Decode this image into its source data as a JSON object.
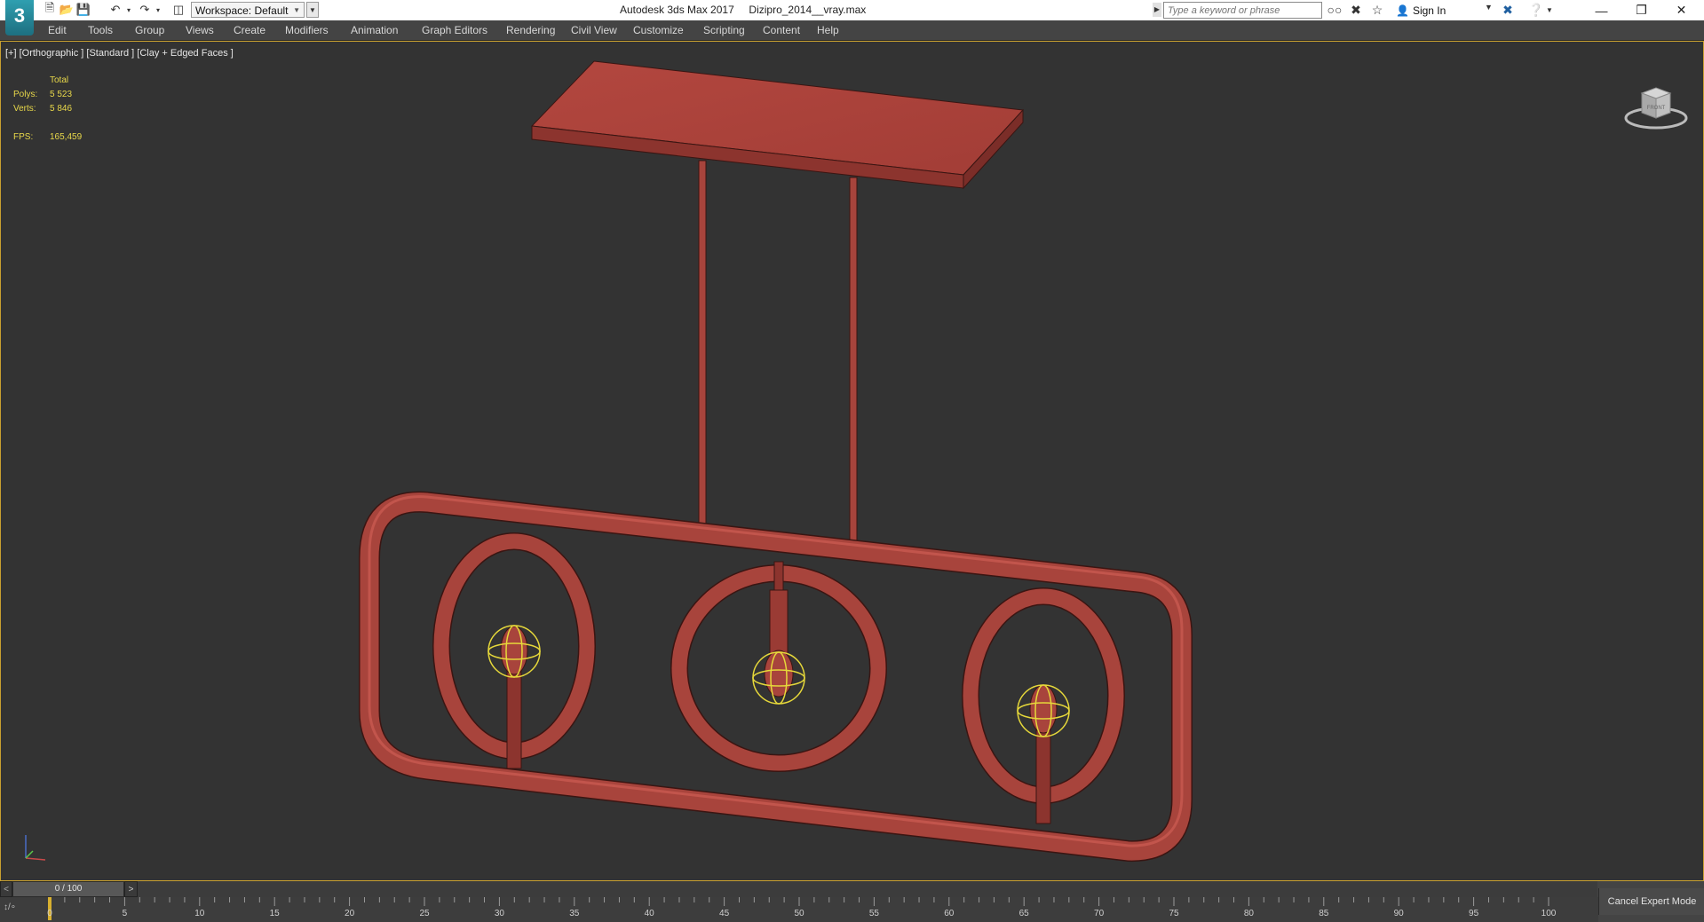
{
  "app": {
    "logo_text": "3",
    "title": "Autodesk 3ds Max 2017     Dizipro_2014__vray.max",
    "workspace_label": "Workspace: Default"
  },
  "search": {
    "placeholder": "Type a keyword or phrase"
  },
  "account": {
    "sign_in_label": "Sign In"
  },
  "menu": [
    "Edit",
    "Tools",
    "Group",
    "Views",
    "Create",
    "Modifiers",
    "Animation",
    "Graph Editors",
    "Rendering",
    "Civil View",
    "Customize",
    "Scripting",
    "Content",
    "Help"
  ],
  "viewport": {
    "label": "[+] [Orthographic ] [Standard ] [Clay + Edged Faces ]",
    "stats": {
      "header": "Total",
      "polys_label": "Polys:",
      "polys_value": "5 523",
      "verts_label": "Verts:",
      "verts_value": "5 846",
      "fps_label": "FPS:",
      "fps_value": "165,459"
    },
    "viewcube_label": "FRONT",
    "model_color": "#a8443c",
    "light_helper_color": "#e6d83a"
  },
  "timeline": {
    "frame_display": "0 / 100",
    "current_frame": 0,
    "total_frames": 100,
    "ticks": [
      "0",
      "5",
      "10",
      "15",
      "20",
      "25",
      "30",
      "35",
      "40",
      "45",
      "50",
      "55",
      "60",
      "65",
      "70",
      "75",
      "80",
      "85",
      "90",
      "95",
      "100"
    ],
    "cancel_expert_mode": "Cancel Expert Mode"
  },
  "colors": {
    "viewport_bg": "#333333",
    "menubar_bg": "#444444",
    "active_border": "#c8a030",
    "stats_text": "#e8d84a"
  },
  "icons": [
    "new-file-icon",
    "open-file-icon",
    "save-icon",
    "undo-icon",
    "redo-icon",
    "project-icon",
    "search-arrow-icon",
    "binoculars-icon",
    "favorites-icon",
    "star-icon",
    "user-icon",
    "exchange-icon",
    "help-icon",
    "minimize-icon",
    "restore-icon",
    "close-icon"
  ]
}
